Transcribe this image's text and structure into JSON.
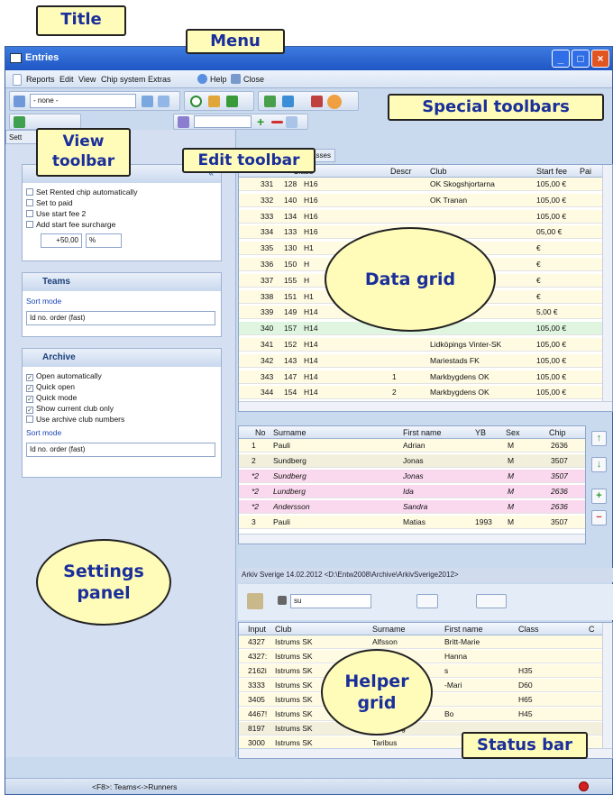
{
  "window": {
    "title": "Entries"
  },
  "menu": [
    "Reports",
    "Edit",
    "View",
    "Chip system",
    "Extras",
    "Help",
    "Close"
  ],
  "view_toolbar": {
    "combo_value": "- none -"
  },
  "tabs": [
    "",
    "asses"
  ],
  "settings_tab_label": "Sett",
  "settings": {
    "general_checks": [
      "Set Rented chip automatically",
      "Set to paid",
      "Use start fee 2",
      "Add start fee surcharge"
    ],
    "surcharge_value": "+50,00",
    "surcharge_unit": "%",
    "teams": {
      "title": "Teams",
      "sort_label": "Sort mode",
      "sort_value": "Id no. order (fast)"
    },
    "archive": {
      "title": "Archive",
      "checks": [
        {
          "label": "Open automatically",
          "checked": true
        },
        {
          "label": "Quick open",
          "checked": true
        },
        {
          "label": "Quick mode",
          "checked": true
        },
        {
          "label": "Show current club only",
          "checked": true
        },
        {
          "label": "Use archive club numbers",
          "checked": false
        }
      ],
      "sort_label": "Sort mode",
      "sort_value": "Id no. order (fast)"
    }
  },
  "data_grid": {
    "headers": [
      "",
      "Class",
      "Descr",
      "Club",
      "Start fee",
      "Pai"
    ],
    "rows": [
      {
        "id": "331",
        "no": "128",
        "cls": "H16",
        "descr": "",
        "club": "OK Skogshjortarna",
        "fee": "105,00 €"
      },
      {
        "id": "332",
        "no": "140",
        "cls": "H16",
        "descr": "",
        "club": "OK Tranan",
        "fee": "105,00 €"
      },
      {
        "id": "333",
        "no": "134",
        "cls": "H16",
        "descr": "",
        "club": "",
        "fee": "105,00 €"
      },
      {
        "id": "334",
        "no": "133",
        "cls": "H16",
        "descr": "",
        "club": "",
        "fee": "05,00 €"
      },
      {
        "id": "335",
        "no": "130",
        "cls": "H1",
        "descr": "",
        "club": "",
        "fee": "€"
      },
      {
        "id": "336",
        "no": "150",
        "cls": "H",
        "descr": "",
        "club": "",
        "fee": "€"
      },
      {
        "id": "337",
        "no": "155",
        "cls": "H",
        "descr": "",
        "club": "",
        "fee": "€"
      },
      {
        "id": "338",
        "no": "151",
        "cls": "H1",
        "descr": "",
        "club": "",
        "fee": "€"
      },
      {
        "id": "339",
        "no": "149",
        "cls": "H14",
        "descr": "",
        "club": "",
        "fee": "5,00 €"
      },
      {
        "id": "340",
        "no": "157",
        "cls": "H14",
        "descr": "",
        "club": "",
        "fee": "105,00 €"
      },
      {
        "id": "341",
        "no": "152",
        "cls": "H14",
        "descr": "",
        "club": "Lidköpings Vinter-SK",
        "fee": "105,00 €"
      },
      {
        "id": "342",
        "no": "143",
        "cls": "H14",
        "descr": "",
        "club": "Mariestads FK",
        "fee": "105,00 €"
      },
      {
        "id": "343",
        "no": "147",
        "cls": "H14",
        "descr": "1",
        "club": "Markbygdens OK",
        "fee": "105,00 €"
      },
      {
        "id": "344",
        "no": "154",
        "cls": "H14",
        "descr": "2",
        "club": "Markbygdens OK",
        "fee": "105,00 €"
      }
    ]
  },
  "runners_grid": {
    "headers": [
      "No",
      "Surname",
      "First name",
      "YB",
      "Sex",
      "Chip"
    ],
    "rows": [
      {
        "no": "1",
        "surname": "Pauli",
        "first": "Adrian",
        "yb": "",
        "sex": "M",
        "chip": "2636"
      },
      {
        "no": "2",
        "surname": "Sundberg",
        "first": "Jonas",
        "yb": "",
        "sex": "M",
        "chip": "3507"
      },
      {
        "no": "*2",
        "surname": "Sundberg",
        "first": "Jonas",
        "yb": "",
        "sex": "M",
        "chip": "3507"
      },
      {
        "no": "*2",
        "surname": "Lundberg",
        "first": "Ida",
        "yb": "",
        "sex": "M",
        "chip": "2636"
      },
      {
        "no": "*2",
        "surname": "Andersson",
        "first": "Sandra",
        "yb": "",
        "sex": "M",
        "chip": "2636"
      },
      {
        "no": "3",
        "surname": "Pauli",
        "first": "Matias",
        "yb": "1993",
        "sex": "M",
        "chip": "3507"
      }
    ]
  },
  "archive_bar": {
    "text": "Arkiv Sverige  14.02.2012  <D:\\Entw2008\\Archive\\ArkivSverige2012>"
  },
  "helper_search": {
    "value": "su"
  },
  "helper_grid": {
    "headers": [
      "Input",
      "Club",
      "Surname",
      "First name",
      "Class",
      "C"
    ],
    "rows": [
      {
        "input": "4327",
        "club": "Istrums SK",
        "surname": "Alfsson",
        "first": "Britt-Marie",
        "cls": ""
      },
      {
        "input": "4327:",
        "club": "Istrums SK",
        "surname": "",
        "first": "Hanna",
        "cls": ""
      },
      {
        "input": "2162i",
        "club": "Istrums SK",
        "surname": "",
        "first": "s",
        "cls": "H35"
      },
      {
        "input": "3333",
        "club": "Istrums SK",
        "surname": "",
        "first": "-Mari",
        "cls": "D60"
      },
      {
        "input": "3405",
        "club": "Istrums SK",
        "surname": "",
        "first": "",
        "cls": "H65"
      },
      {
        "input": "4467!",
        "club": "Istrums SK",
        "surname": "",
        "first": "Bo",
        "cls": "H45"
      },
      {
        "input": "8197",
        "club": "Istrums SK",
        "surname": "Sundberg",
        "first": "",
        "cls": ""
      },
      {
        "input": "3000",
        "club": "Istrums SK",
        "surname": "Taribus",
        "first": "",
        "cls": ""
      }
    ]
  },
  "status_bar": {
    "text": "<F8>: Teams<->Runners"
  },
  "callouts": {
    "title": "Title",
    "menu": "Menu",
    "special": "Special toolbars",
    "view1": "View",
    "view2": "toolbar",
    "edit": "Edit toolbar",
    "data": "Data grid",
    "settings1": "Settings",
    "settings2": "panel",
    "helper1": "Helper",
    "helper2": "grid",
    "status": "Status bar"
  }
}
